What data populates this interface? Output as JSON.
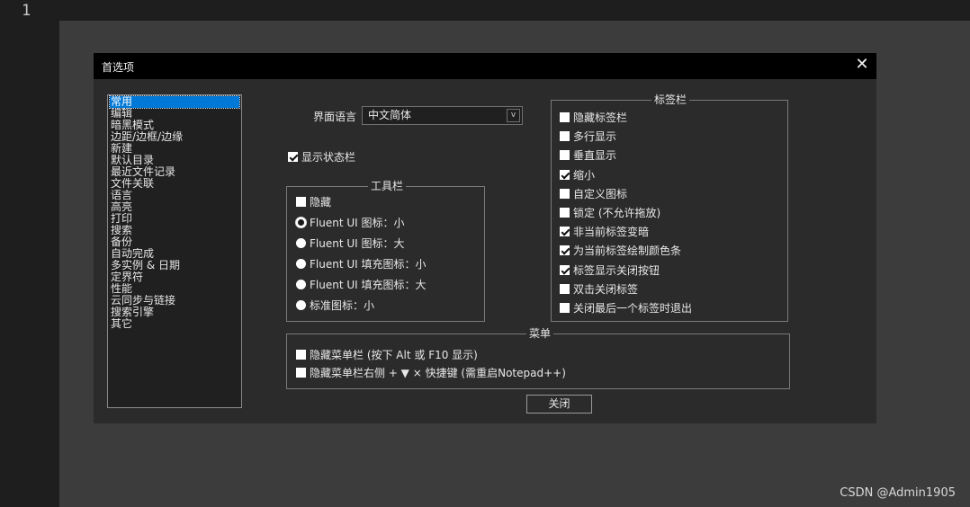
{
  "editor": {
    "line_number": "1",
    "watermark": "CSDN @Admin1905"
  },
  "dialog": {
    "title": "首选项",
    "close_symbol": "✕",
    "categories": [
      "常用",
      "编辑",
      "暗黑模式",
      "边距/边框/边缘",
      "新建",
      "默认目录",
      "最近文件记录",
      "文件关联",
      "语言",
      "高亮",
      "打印",
      "搜索",
      "备份",
      "自动完成",
      "多实例 & 日期",
      "定界符",
      "性能",
      "云同步与链接",
      "搜索引擎",
      "其它"
    ],
    "selected_category": "常用",
    "language": {
      "label": "界面语言",
      "value": "中文简体",
      "arrow": "v"
    },
    "show_statusbar": {
      "label": "显示状态栏",
      "checked": true
    },
    "toolbar": {
      "title": "工具栏",
      "hide": {
        "label": "隐藏",
        "checked": false
      },
      "options": [
        {
          "label": "Fluent UI 图标：小",
          "checked": true
        },
        {
          "label": "Fluent UI 图标：大",
          "checked": false
        },
        {
          "label": "Fluent UI 填充图标：小",
          "checked": false
        },
        {
          "label": "Fluent UI 填充图标：大",
          "checked": false
        },
        {
          "label": "标准图标：小",
          "checked": false
        }
      ]
    },
    "tabbar": {
      "title": "标签栏",
      "options": [
        {
          "label": "隐藏标签栏",
          "checked": false
        },
        {
          "label": "多行显示",
          "checked": false
        },
        {
          "label": "垂直显示",
          "checked": false
        },
        {
          "label": "缩小",
          "checked": true
        },
        {
          "label": "自定义图标",
          "checked": false
        },
        {
          "label": "锁定 (不允许拖放)",
          "checked": false
        },
        {
          "label": "非当前标签变暗",
          "checked": true
        },
        {
          "label": "为当前标签绘制颜色条",
          "checked": true
        },
        {
          "label": "标签显示关闭按钮",
          "checked": true
        },
        {
          "label": "双击关闭标签",
          "checked": false
        },
        {
          "label": "关闭最后一个标签时退出",
          "checked": false
        }
      ]
    },
    "menu": {
      "title": "菜单",
      "options": [
        {
          "label": "隐藏菜单栏 (按下 Alt 或 F10 显示)",
          "checked": false
        },
        {
          "label": "隐藏菜单栏右侧 + ▼ × 快捷键 (需重启Notepad++)",
          "checked": false
        }
      ]
    },
    "close_button": "关闭"
  }
}
